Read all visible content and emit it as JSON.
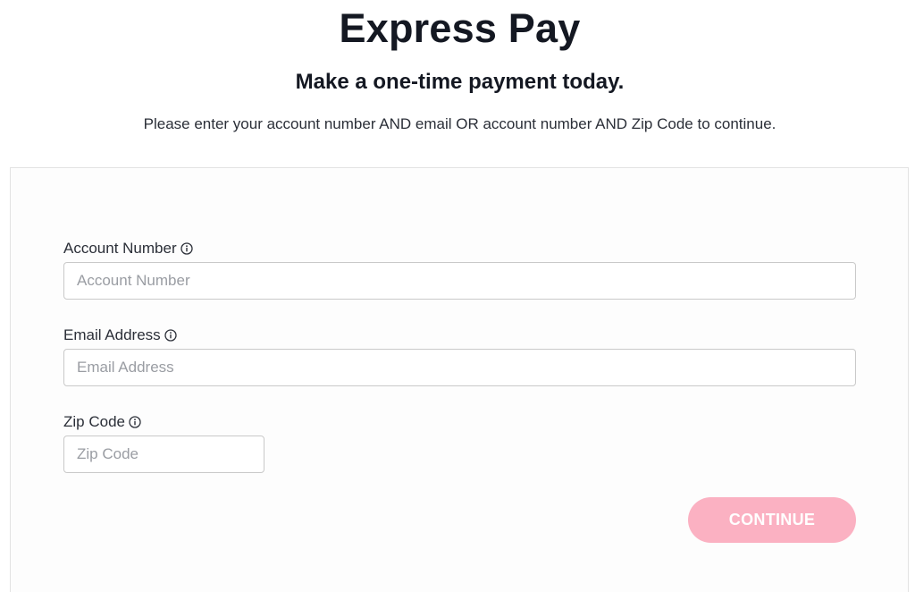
{
  "header": {
    "title": "Express Pay",
    "subtitle": "Make a one-time payment today.",
    "instructions": "Please enter your account number AND email OR account number AND Zip Code to continue."
  },
  "form": {
    "account_number": {
      "label": "Account Number",
      "placeholder": "Account Number",
      "value": ""
    },
    "email": {
      "label": "Email Address",
      "placeholder": "Email Address",
      "value": ""
    },
    "zip": {
      "label": "Zip Code",
      "placeholder": "Zip Code",
      "value": ""
    },
    "continue_label": "CONTINUE"
  },
  "colors": {
    "button_disabled": "#fbb1c2",
    "text_dark": "#141822"
  },
  "icons": {
    "info": "info-circle-icon"
  }
}
